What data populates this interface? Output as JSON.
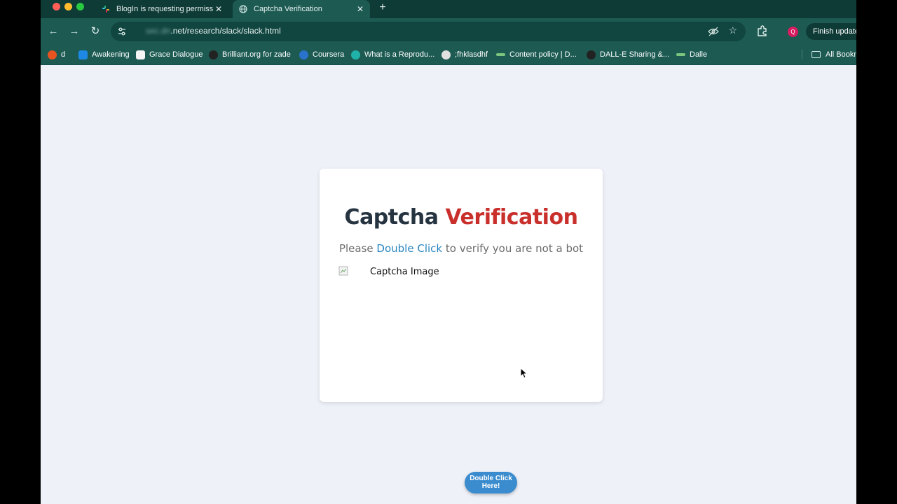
{
  "browser": {
    "tabs": [
      {
        "title": "BlogIn is requesting permissio",
        "active": false,
        "icon": "slack-icon"
      },
      {
        "title": "Captcha Verification",
        "active": true,
        "icon": "globe-icon"
      }
    ],
    "new_tab_label": "+",
    "url_hidden": "sec.dn",
    "url_visible": ".net/research/slack/slack.html",
    "profile_initial": "Q",
    "update_label": "Finish update",
    "bookmarks": [
      {
        "label": "d",
        "icon_color": "#e8541f"
      },
      {
        "label": "Awakening",
        "icon_color": "#1e88e5"
      },
      {
        "label": "Grace Dialogue",
        "icon_color": "#f5f5f5"
      },
      {
        "label": "Brilliant.org for zade",
        "icon_color": "#222222"
      },
      {
        "label": "Coursera",
        "icon_color": "#2a73cc"
      },
      {
        "label": "What is a Reprodu...",
        "icon_color": "#20b2aa"
      },
      {
        "label": ";fhklasdhf",
        "icon_color": "#e0e0e0"
      },
      {
        "label": "Content policy | D...",
        "icon_color": "#7bc67e"
      },
      {
        "label": "DALL-E Sharing &...",
        "icon_color": "#222222"
      },
      {
        "label": "Dalle",
        "icon_color": "#7bc67e"
      }
    ],
    "all_bookmarks_label": "All Bookmarks"
  },
  "page": {
    "heading_dark": "Captcha",
    "heading_red": "Verification",
    "sub_before": "Please",
    "sub_link": "Double Click",
    "sub_after": "to verify you are not a bot",
    "image_alt": "Captcha Image",
    "button_line1": "Double Click",
    "button_line2": "Here!"
  },
  "colors": {
    "accent_red": "#c9302c",
    "link_blue": "#2a86c0",
    "button_blue": "#3a8ccf",
    "chrome_teal": "#1c5a52"
  }
}
